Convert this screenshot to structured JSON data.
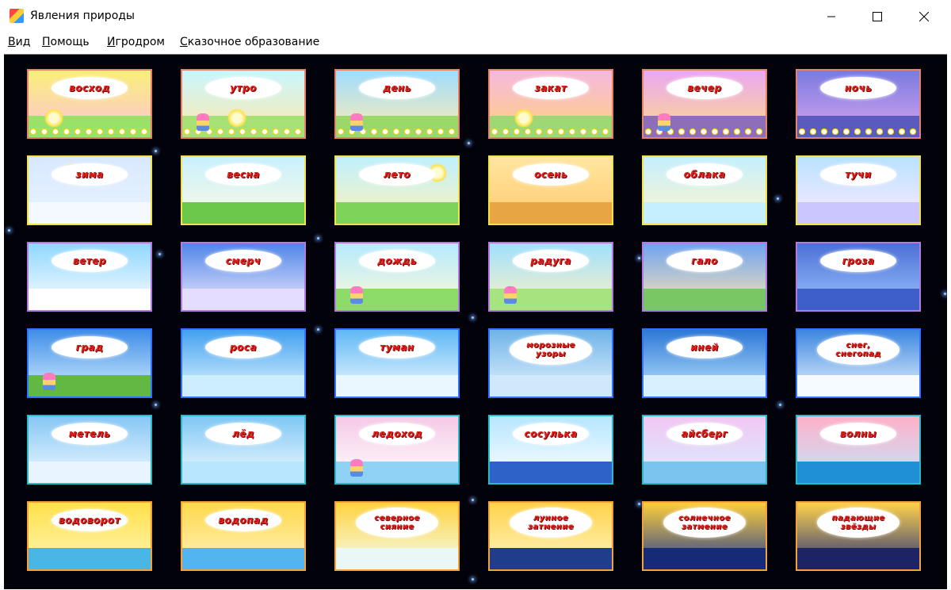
{
  "window": {
    "title": "Явления природы",
    "icons": {
      "minimize": "minimize-icon",
      "maximize": "maximize-icon",
      "close": "close-icon"
    }
  },
  "menu": {
    "items": [
      "Вид",
      "Помощь",
      "Игродром",
      "Сказочное образование"
    ]
  },
  "tiles": [
    {
      "label": "восход",
      "border": "#e8826a",
      "sky": [
        "#f9ef7a",
        "#ffc3d6"
      ],
      "ground": "#9ae16a",
      "sun": true
    },
    {
      "label": "утро",
      "border": "#e8826a",
      "sky": [
        "#c9f6ff",
        "#ffe9a8"
      ],
      "ground": "#a7e074",
      "sun": true
    },
    {
      "label": "день",
      "border": "#e8826a",
      "sky": [
        "#9fdcff",
        "#ffeeb0"
      ],
      "ground": "#9ad86a",
      "sun": false
    },
    {
      "label": "закат",
      "border": "#e8826a",
      "sky": [
        "#f6b8e0",
        "#ffd27a"
      ],
      "ground": "#9ed874",
      "sun": true
    },
    {
      "label": "вечер",
      "border": "#e8826a",
      "sky": [
        "#e9a7f2",
        "#ffd98a"
      ],
      "ground": "#8c6fb8",
      "sun": false
    },
    {
      "label": "ночь",
      "border": "#e8826a",
      "sky": [
        "#7a7adf",
        "#d7a5f0"
      ],
      "ground": "#5b5bbd",
      "sun": false
    },
    {
      "label": "зима",
      "border": "#f2e14a",
      "sky": [
        "#d8e8ff",
        "#e9f4ff"
      ],
      "ground": "#f4f8ff",
      "sun": true
    },
    {
      "label": "весна",
      "border": "#f2e14a",
      "sky": [
        "#c8f0ff",
        "#fffbe0"
      ],
      "ground": "#6cc84a",
      "sun": false
    },
    {
      "label": "лето",
      "border": "#f2e14a",
      "sky": [
        "#bff0ff",
        "#fff3b8"
      ],
      "ground": "#7ed35a",
      "sun": true
    },
    {
      "label": "осень",
      "border": "#f2e14a",
      "sky": [
        "#ffe6a0",
        "#ffc96f"
      ],
      "ground": "#e8a544",
      "sun": false
    },
    {
      "label": "облака",
      "border": "#f2e14a",
      "sky": [
        "#c5efff",
        "#fff6c8"
      ],
      "ground": "#c5efff",
      "sun": false
    },
    {
      "label": "тучи",
      "border": "#f2e14a",
      "sky": [
        "#b9e2ff",
        "#ffe9ff"
      ],
      "ground": "#ccc6ff",
      "sun": false
    },
    {
      "label": "ветер",
      "border": "#b57adf",
      "sky": [
        "#8fd7ff",
        "#ffffff"
      ],
      "ground": "#ffffff",
      "sun": true
    },
    {
      "label": "смерч",
      "border": "#b57adf",
      "sky": [
        "#4f86e8",
        "#f1eaff"
      ],
      "ground": "#e5ddff",
      "sun": false
    },
    {
      "label": "дождь",
      "border": "#b57adf",
      "sky": [
        "#b4eaff",
        "#fff9d6"
      ],
      "ground": "#8ddc6a",
      "sun": false
    },
    {
      "label": "радуга",
      "border": "#b57adf",
      "sky": [
        "#9fe0ff",
        "#fff2c2"
      ],
      "ground": "#a6e47d",
      "sun": true
    },
    {
      "label": "гало",
      "border": "#b57adf",
      "sky": [
        "#6ea3f0",
        "#ffe7b3"
      ],
      "ground": "#77c864",
      "sun": false
    },
    {
      "label": "гроза",
      "border": "#b57adf",
      "sky": [
        "#4d6fd6",
        "#9ac6ff"
      ],
      "ground": "#3e5fc8",
      "sun": false
    },
    {
      "label": "град",
      "border": "#2f72ff",
      "sky": [
        "#3f8de8",
        "#d6f0ff"
      ],
      "ground": "#63b844",
      "sun": false
    },
    {
      "label": "роса",
      "border": "#2f72ff",
      "sky": [
        "#43a0f0",
        "#dff7ff"
      ],
      "ground": "#cdeefe",
      "sun": false
    },
    {
      "label": "туман",
      "border": "#2f72ff",
      "sky": [
        "#5fb8f5",
        "#f4fbff"
      ],
      "ground": "#eaf7ff",
      "sun": false
    },
    {
      "label": "морозные\nузоры",
      "border": "#2f72ff",
      "sky": [
        "#6fb3e8",
        "#e5f4ff"
      ],
      "ground": "#cfe8fb",
      "sun": false
    },
    {
      "label": "иней",
      "border": "#2f72ff",
      "sky": [
        "#2d78d6",
        "#bde6ff"
      ],
      "ground": "#d8f0ff",
      "sun": false
    },
    {
      "label": "снег,\nснегопад",
      "border": "#2f72ff",
      "sky": [
        "#3d86e0",
        "#eaf6ff"
      ],
      "ground": "#f5fbff",
      "sun": false
    },
    {
      "label": "метель",
      "border": "#29b9c8",
      "sky": [
        "#86c6f5",
        "#f2fbff"
      ],
      "ground": "#e8f4ff",
      "sun": false
    },
    {
      "label": "лёд",
      "border": "#29b9c8",
      "sky": [
        "#7fc7f4",
        "#f3fbff"
      ],
      "ground": "#b8e6ff",
      "sun": false
    },
    {
      "label": "ледоход",
      "border": "#29b9c8",
      "sky": [
        "#f5c9e6",
        "#ffffff"
      ],
      "ground": "#8fd2f5",
      "sun": true
    },
    {
      "label": "сосулька",
      "border": "#29b9c8",
      "sky": [
        "#b6e6ff",
        "#ffffff"
      ],
      "ground": "#2e62c8",
      "sun": false
    },
    {
      "label": "айсберг",
      "border": "#29b9c8",
      "sky": [
        "#f2c6f2",
        "#d6f0ff"
      ],
      "ground": "#7ac4f0",
      "sun": false
    },
    {
      "label": "волны",
      "border": "#29b9c8",
      "sky": [
        "#ffb0c8",
        "#bfe7ff"
      ],
      "ground": "#1f8fd6",
      "sun": false
    },
    {
      "label": "водоворот",
      "border": "#f4a13a",
      "sky": [
        "#ffe04a",
        "#fff7b8"
      ],
      "ground": "#4ab6e6",
      "sun": false
    },
    {
      "label": "водопад",
      "border": "#f4a13a",
      "sky": [
        "#ffd84a",
        "#fff3c2"
      ],
      "ground": "#53b5f0",
      "sun": false
    },
    {
      "label": "северное\nсияние",
      "border": "#f4a13a",
      "sky": [
        "#ffd23f",
        "#f2fff4"
      ],
      "ground": "#e9f8f6",
      "sun": false
    },
    {
      "label": "лунное\nзатмение",
      "border": "#f4a13a",
      "sky": [
        "#ffd24a",
        "#fff7c7"
      ],
      "ground": "#1f3d8a",
      "sun": true
    },
    {
      "label": "солнечное\nзатмение",
      "border": "#f4a13a",
      "sky": [
        "#ffce3a",
        "#1e3a96"
      ],
      "ground": "#152b78",
      "sun": true
    },
    {
      "label": "падающие\nзвёзды",
      "border": "#f4a13a",
      "sky": [
        "#ffd24a",
        "#24307e"
      ],
      "ground": "#1c2466",
      "sun": false
    }
  ]
}
